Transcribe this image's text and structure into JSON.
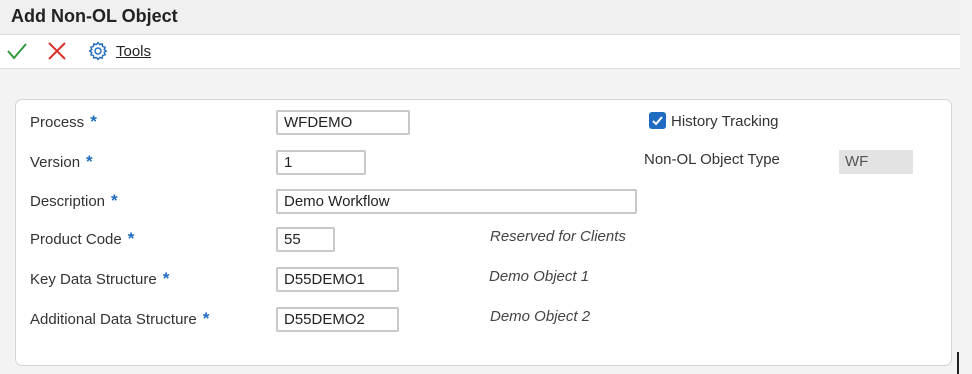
{
  "window": {
    "title": "Add Non-OL Object"
  },
  "toolbar": {
    "ok_icon": "checkmark-icon",
    "cancel_icon": "x-icon",
    "tools_icon": "gear-icon",
    "tools_label": "Tools"
  },
  "form": {
    "process": {
      "label": "Process",
      "required": "*",
      "value": "WFDEMO"
    },
    "version": {
      "label": "Version",
      "required": "*",
      "value": "1"
    },
    "description": {
      "label": "Description",
      "required": "*",
      "value": "Demo Workflow"
    },
    "product_code": {
      "label": "Product Code",
      "required": "*",
      "value": "55",
      "note": "Reserved for Clients"
    },
    "key_data_structure": {
      "label": "Key Data Structure",
      "required": "*",
      "value": "D55DEMO1",
      "note": "Demo Object 1"
    },
    "additional_data_structure": {
      "label": "Additional Data Structure",
      "required": "*",
      "value": "D55DEMO2",
      "note": "Demo Object 2"
    },
    "history_tracking": {
      "label": "History Tracking",
      "checked": true
    },
    "object_type": {
      "label": "Non-OL Object Type",
      "value": "WF"
    }
  },
  "colors": {
    "accent": "#1e6bc1",
    "ok_green": "#2e9b3c",
    "cancel_red": "#d9342b"
  }
}
